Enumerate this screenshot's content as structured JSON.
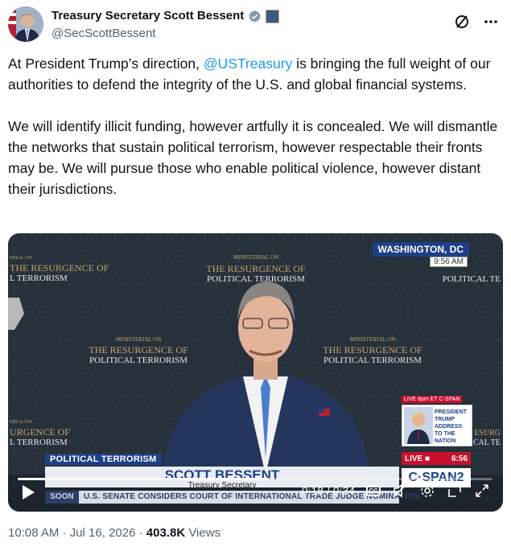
{
  "author": {
    "display_name": "Treasury Secretary Scott Bessent",
    "handle": "@SecScottBessent"
  },
  "header_actions": {
    "grok_icon": "slash-circle-icon",
    "more_icon": "more-dots-icon"
  },
  "tweet": {
    "p1_before": "At President Trump’s direction, ",
    "p1_mention": "@USTreasury",
    "p1_after": " is bringing the full weight of our authorities to defend the integrity of the U.S. and global financial systems.",
    "p2": "We will identify illicit funding, however artfully it is concealed. We will dismantle the networks that sustain political terrorism, however respectable their fronts may be. We will pursue those who enable political violence, however distant their jurisdictions."
  },
  "video": {
    "backdrop_line1": "MINISTERIAL ON",
    "backdrop_line2": "THE RESURGENCE OF",
    "backdrop_line3": "POLITICAL TERRORISM",
    "location": "WASHINGTON, DC",
    "bug_time": "9:56 AM",
    "lower_tag": "POLITICAL TERRORISM",
    "chyron_name": "SCOTT BESSENT",
    "chyron_title": "Treasury Secretary",
    "soon_label": "SOON",
    "ticker": "U.S. SENATE CONSIDERS COURT OF INTERNATIONAL TRADE JUDGE NOMINATION",
    "promo_time": "LIVE 8pm ET C-SPAN",
    "promo_text": "PRESIDENT TRUMP ADDRESS TO THE NATION",
    "live_label": "LIVE ■",
    "live_time": "6:56",
    "network": "C·SPAN2",
    "elapsed": "0:18",
    "duration": "0:34",
    "time_display": "0:18 / 0:34",
    "progress_fraction": 0.53,
    "cc_label": "CC"
  },
  "footer": {
    "timestamp": "10:08 AM · Jul 16, 2026 · ",
    "views_count": "403.8K",
    "views_label": " Views"
  }
}
